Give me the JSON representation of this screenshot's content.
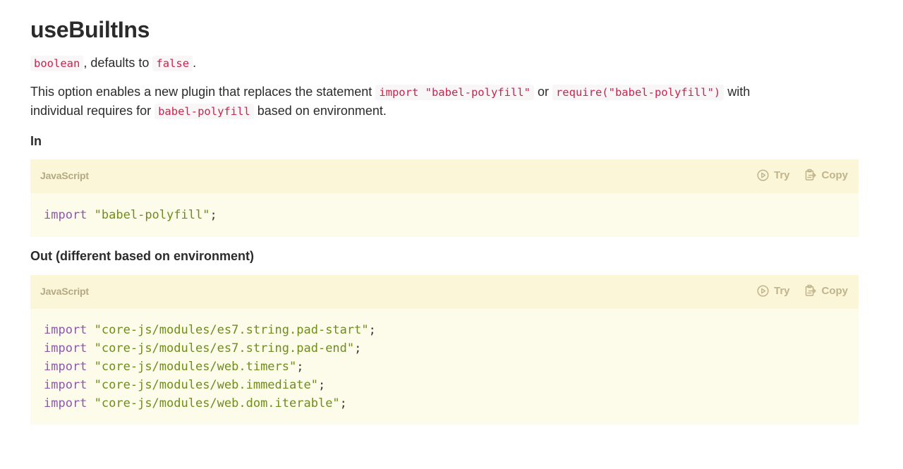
{
  "title": "useBuiltIns",
  "type_line": {
    "type": "boolean",
    "middle": ", defaults to ",
    "default": "false",
    "end": "."
  },
  "description": {
    "part1": "This option enables a new plugin that replaces the statement ",
    "code1": "import \"babel-polyfill\"",
    "part2": " or ",
    "code2": "require(\"babel-polyfill\")",
    "part3": " with",
    "part4": "individual requires for ",
    "code3": "babel-polyfill",
    "part5": " based on environment."
  },
  "in_heading": "In",
  "out_heading": "Out (different based on environment)",
  "code_in": {
    "language": "JavaScript",
    "try_label": "Try",
    "copy_label": "Copy",
    "lines": [
      {
        "keyword": "import",
        "string": "\"babel-polyfill\"",
        "punct": ";"
      }
    ]
  },
  "code_out": {
    "language": "JavaScript",
    "try_label": "Try",
    "copy_label": "Copy",
    "lines": [
      {
        "keyword": "import",
        "string": "\"core-js/modules/es7.string.pad-start\"",
        "punct": ";"
      },
      {
        "keyword": "import",
        "string": "\"core-js/modules/es7.string.pad-end\"",
        "punct": ";"
      },
      {
        "keyword": "import",
        "string": "\"core-js/modules/web.timers\"",
        "punct": ";"
      },
      {
        "keyword": "import",
        "string": "\"core-js/modules/web.immediate\"",
        "punct": ";"
      },
      {
        "keyword": "import",
        "string": "\"core-js/modules/web.dom.iterable\"",
        "punct": ";"
      }
    ]
  },
  "icons": {
    "try": "play-circle-icon",
    "copy": "clipboard-icon"
  },
  "colors": {
    "inline_code": "#c7254e",
    "keyword": "#8e58aa",
    "string": "#6f8c1d",
    "code_bar": "#fbf6d8",
    "code_bg": "#fdfbea",
    "action": "#c0b48d"
  }
}
